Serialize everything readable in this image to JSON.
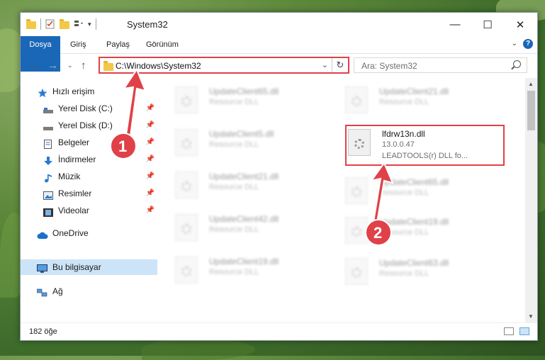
{
  "window": {
    "title": "System32",
    "controls": {
      "minimize": "—",
      "maximize": "☐",
      "close": "✕"
    }
  },
  "ribbon": {
    "tabs": [
      "Dosya",
      "Giriş",
      "Paylaş",
      "Görünüm"
    ],
    "help": "?"
  },
  "address": {
    "path": "C:\\Windows\\System32",
    "search_placeholder": "Ara: System32"
  },
  "sidebar": {
    "items": [
      {
        "label": "Hızlı erişim",
        "icon": "star-icon"
      },
      {
        "label": "Yerel Disk (C:)",
        "icon": "drive-icon",
        "pinned": true
      },
      {
        "label": "Yerel Disk (D:)",
        "icon": "drive-icon",
        "pinned": true
      },
      {
        "label": "Belgeler",
        "icon": "documents-icon",
        "pinned": true
      },
      {
        "label": "İndirmeler",
        "icon": "download-icon",
        "pinned": true
      },
      {
        "label": "Müzik",
        "icon": "music-icon",
        "pinned": true
      },
      {
        "label": "Resimler",
        "icon": "pictures-icon",
        "pinned": true
      },
      {
        "label": "Videolar",
        "icon": "video-icon",
        "pinned": true
      },
      {
        "label": "OneDrive",
        "icon": "cloud-icon"
      },
      {
        "label": "Bu bilgisayar",
        "icon": "computer-icon",
        "selected": true
      },
      {
        "label": "Ağ",
        "icon": "network-icon"
      }
    ]
  },
  "files": {
    "left": [
      {
        "name": "UpdateClient65.dll",
        "desc": "Resource DLL"
      },
      {
        "name": "UpdateClient5.dll",
        "desc": "Resource DLL"
      },
      {
        "name": "UpdateClient21.dll",
        "desc": "Resource DLL"
      },
      {
        "name": "UpdateClient42.dll",
        "desc": "Resource DLL"
      },
      {
        "name": "UpdateClient19.dll",
        "desc": "Resource DLL"
      }
    ],
    "right": [
      {
        "name": "UpdateClient21.dll",
        "desc": "Resource DLL"
      },
      {
        "name": "UpdateClient65.dll",
        "desc": "Resource DLL"
      },
      {
        "name": "UpdateClient19.dll",
        "desc": "Resource DLL"
      },
      {
        "name": "UpdateClient63.dll",
        "desc": "Resource DLL"
      }
    ],
    "highlighted": {
      "name": "lfdrw13n.dll",
      "version": "13.0.0.47",
      "desc": "LEADTOOLS(r) DLL fo..."
    }
  },
  "annotations": {
    "step1": "1",
    "step2": "2",
    "color": "#e04148"
  },
  "status": {
    "count": "182 öğe"
  }
}
